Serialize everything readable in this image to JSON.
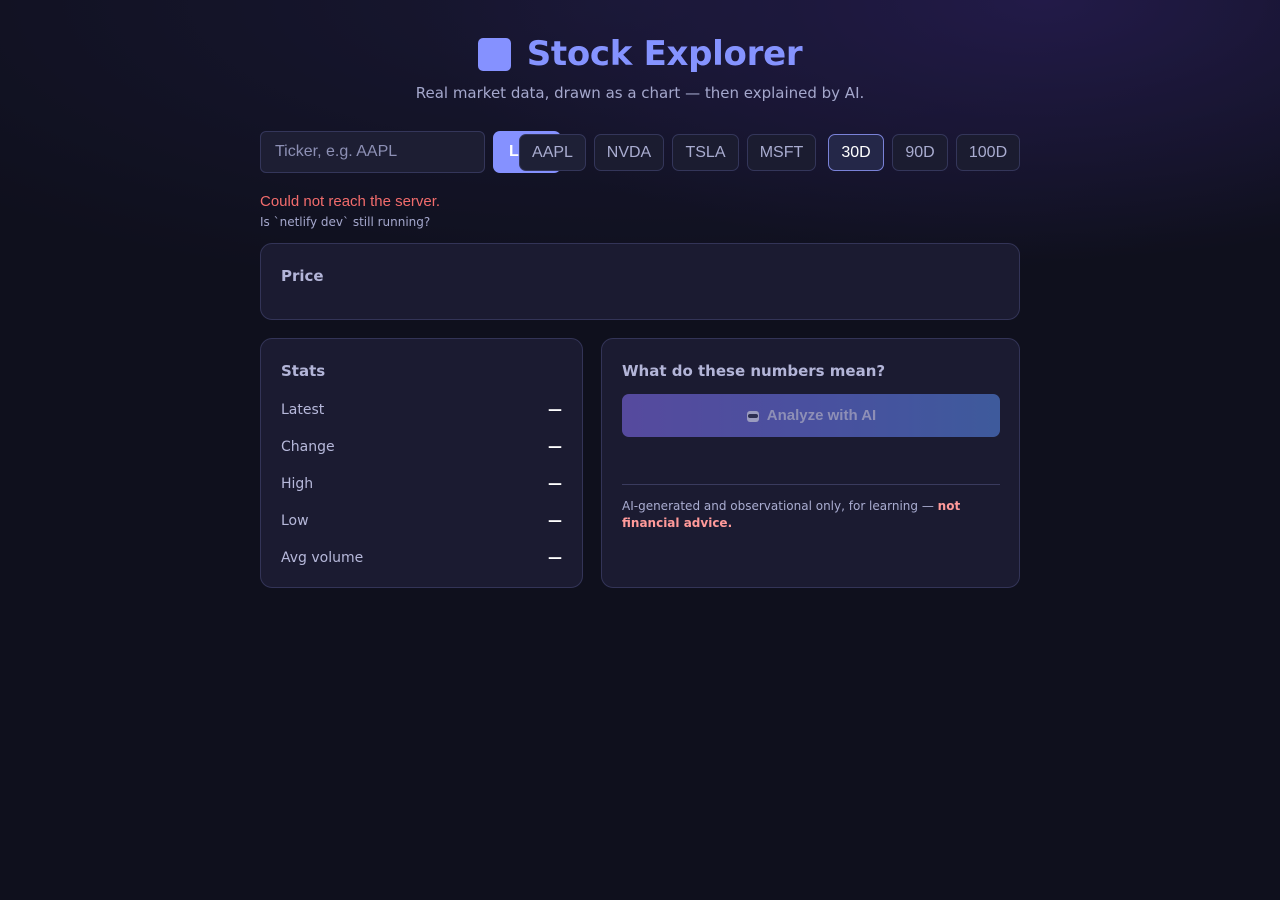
{
  "header": {
    "title": "Stock Explorer",
    "subtitle": "Real market data, drawn as a chart — then explained by AI."
  },
  "search": {
    "placeholder": "Ticker, e.g. AAPL",
    "value": "",
    "load_label": "Load"
  },
  "ticker_chips": [
    "AAPL",
    "NVDA",
    "TSLA",
    "MSFT"
  ],
  "range_chips": {
    "options": [
      "30D",
      "90D",
      "100D"
    ],
    "selected": "30D"
  },
  "error": {
    "message": "Could not reach the server.",
    "hint": "Is `netlify dev` still running?"
  },
  "price_card": {
    "title": "Price"
  },
  "stats_card": {
    "title": "Stats",
    "rows": [
      {
        "label": "Latest",
        "value": "—"
      },
      {
        "label": "Change",
        "value": "—"
      },
      {
        "label": "High",
        "value": "—"
      },
      {
        "label": "Low",
        "value": "—"
      },
      {
        "label": "Avg volume",
        "value": "—"
      }
    ]
  },
  "ai_card": {
    "title": "What do these numbers mean?",
    "analyze_label": "Analyze with AI",
    "analyze_icon": "robot-icon",
    "disclaimer_prefix": "AI-generated and observational only, for learning — ",
    "disclaimer_strong": "not financial advice."
  },
  "colors": {
    "accent": "#8591ff",
    "error": "#f26c6c",
    "warning_strong": "#ff9a9a",
    "background": "#0f101d",
    "card": "#1b1b31"
  }
}
